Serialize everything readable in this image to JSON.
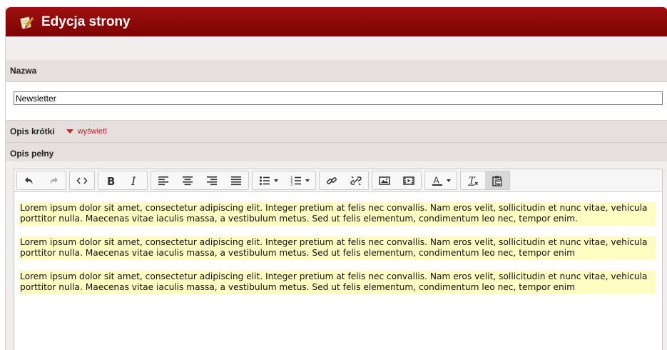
{
  "header": {
    "title": "Edycja strony",
    "icon": "edit-page-icon"
  },
  "fields": {
    "name_label": "Nazwa",
    "name_value": "Newsletter",
    "short_desc_label": "Opis krótki",
    "short_desc_toggle": "wyświetl",
    "full_desc_label": "Opis pełny"
  },
  "toolbar": {
    "groups": [
      [
        "undo-icon",
        "redo-icon"
      ],
      [
        "source-code-icon"
      ],
      [
        "bold-icon",
        "italic-icon"
      ],
      [
        "align-left-icon",
        "align-center-icon",
        "align-right-icon",
        "align-justify-icon"
      ],
      [
        "bulleted-list-icon",
        "numbered-list-icon"
      ],
      [
        "link-icon",
        "unlink-icon"
      ],
      [
        "image-icon",
        "video-icon"
      ],
      [
        "text-color-icon"
      ],
      [
        "clear-formatting-icon",
        "paste-icon"
      ]
    ]
  },
  "content": {
    "paragraphs": [
      "Lorem ipsum dolor sit amet, consectetur adipiscing elit. Integer pretium at felis nec convallis. Nam eros velit, sollicitudin et nunc vitae, vehicula porttitor nulla. Maecenas vitae iaculis massa, a vestibulum metus. Sed ut felis elementum, condimentum leo nec, tempor enim.",
      "Lorem ipsum dolor sit amet, consectetur adipiscing elit. Integer pretium at felis nec convallis. Nam eros velit, sollicitudin et nunc vitae, vehicula porttitor nulla. Maecenas vitae iaculis massa, a vestibulum metus. Sed ut felis elementum, condimentum leo nec, tempor enim",
      "Lorem ipsum dolor sit amet, consectetur adipiscing elit. Integer pretium at felis nec convallis. Nam eros velit, sollicitudin et nunc vitae, vehicula porttitor nulla. Maecenas vitae iaculis massa, a vestibulum metus. Sed ut felis elementum, condimentum leo nec, tempor enim"
    ]
  },
  "colors": {
    "header": "#8c0a0a",
    "highlight": "#fffdc2",
    "toggle": "#c02020"
  }
}
